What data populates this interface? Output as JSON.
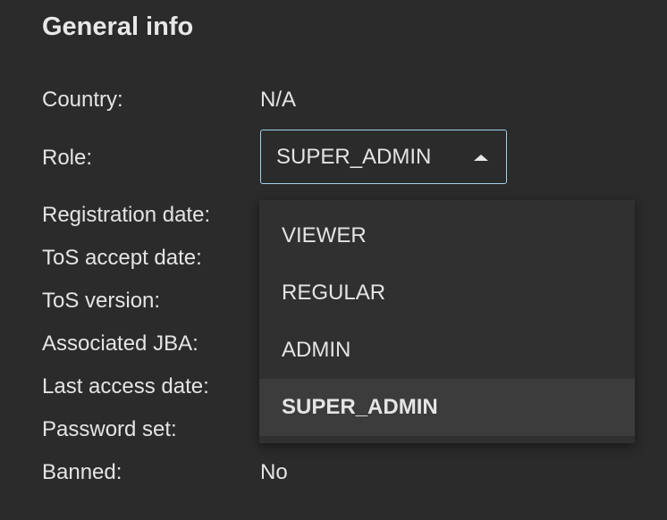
{
  "title": "General info",
  "fields": [
    {
      "label": "Country:",
      "value": "N/A"
    },
    {
      "label": "Role:"
    },
    {
      "label": "Registration date:"
    },
    {
      "label": "ToS accept date:"
    },
    {
      "label": "ToS version:"
    },
    {
      "label": "Associated JBA:"
    },
    {
      "label": "Last access date:"
    },
    {
      "label": "Password set:"
    },
    {
      "label": "Banned:",
      "value": "No"
    }
  ],
  "role_select": {
    "selected": "SUPER_ADMIN",
    "options": [
      "VIEWER",
      "REGULAR",
      "ADMIN",
      "SUPER_ADMIN"
    ]
  },
  "colors": {
    "background": "#2b2b2b",
    "focus_border": "#9fd3ea",
    "menu": "#303030",
    "menu_selected": "#3c3c3c"
  }
}
